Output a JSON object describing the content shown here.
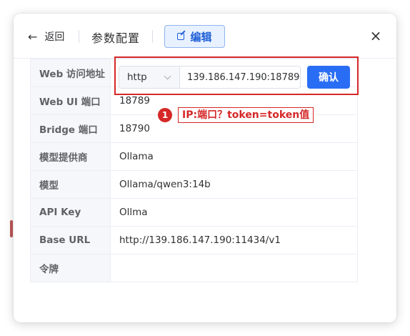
{
  "header": {
    "back_label": "返回",
    "title": "参数配置",
    "edit_label": "编辑",
    "close_symbol": "×"
  },
  "icons": {
    "back": "arrow-left-icon",
    "edit": "edit-icon",
    "close": "close-icon",
    "select": "chevron-down-icon"
  },
  "web_url": {
    "label": "Web 访问地址",
    "protocol": "http",
    "address": "139.186.147.190:18789",
    "confirm_label": "确认"
  },
  "rows": [
    {
      "label": "Web UI 端口",
      "value": "18789"
    },
    {
      "label": "Bridge 端口",
      "value": "18790"
    },
    {
      "label": "模型提供商",
      "value": "Ollama"
    },
    {
      "label": "模型",
      "value": "Ollama/qwen3:14b"
    },
    {
      "label": "API Key",
      "value": "Ollma"
    },
    {
      "label": "Base URL",
      "value": "http://139.186.147.190:11434/v1"
    },
    {
      "label": "令牌",
      "value": ""
    }
  ],
  "annotation": {
    "number": "1",
    "text": "IP:端口？token=token值"
  },
  "colors": {
    "accent": "#2a6df5",
    "annotation_red": "#d62828",
    "label_bg": "#f5f7fa"
  }
}
